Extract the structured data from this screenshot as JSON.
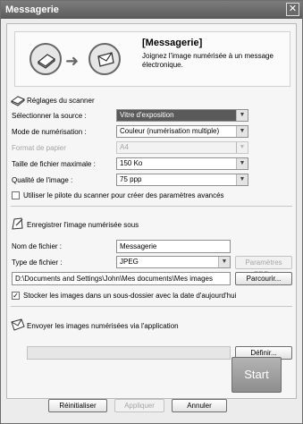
{
  "window": {
    "title": "Messagerie",
    "close_glyph": "✕"
  },
  "header": {
    "title": "[Messagerie]",
    "description": "Joignez l'image numérisée à un message électronique.",
    "icons": [
      "scanner-icon",
      "arrow-right-icon",
      "mail-icon"
    ]
  },
  "scanner_settings": {
    "title": "Réglages du scanner",
    "source": {
      "label": "Sélectionner la source :",
      "value": "Vitre d'exposition"
    },
    "mode": {
      "label": "Mode de numérisation :",
      "value": "Couleur (numérisation multiple)"
    },
    "paper": {
      "label": "Format de papier",
      "value": "A4"
    },
    "max_size": {
      "label": "Taille de fichier maximale :",
      "value": "150 Ko"
    },
    "quality": {
      "label": "Qualité de l'image :",
      "value": "75 ppp"
    },
    "driver_option": {
      "label": "Utiliser le pilote du scanner pour créer des paramètres avancés",
      "checked": false
    }
  },
  "save": {
    "title": "Enregistrer l'image numérisée sous",
    "filename": {
      "label": "Nom de fichier :",
      "value": "Messagerie"
    },
    "filetype": {
      "label": "Type de fichier :",
      "value": "JPEG"
    },
    "pdf_settings": "Paramètres PDF...",
    "path": "D:\\Documents and Settings\\John\\Mes documents\\Mes images",
    "browse": "Parcourir...",
    "subfolder_option": {
      "label": "Stocker les images dans un sous-dossier avec la date d'aujourd'hui",
      "checked": true
    }
  },
  "send": {
    "title": "Envoyer les images numérisées via l'application",
    "application": "",
    "define": "Définir..."
  },
  "footer": {
    "reset": "Réinitialiser",
    "apply": "Appliquer",
    "cancel": "Annuler",
    "start": "Start"
  },
  "colors": {
    "titlebar": "#5a5a5a",
    "selected_combo": "#5a5a5a",
    "disabled_text": "#a5a5a5"
  }
}
